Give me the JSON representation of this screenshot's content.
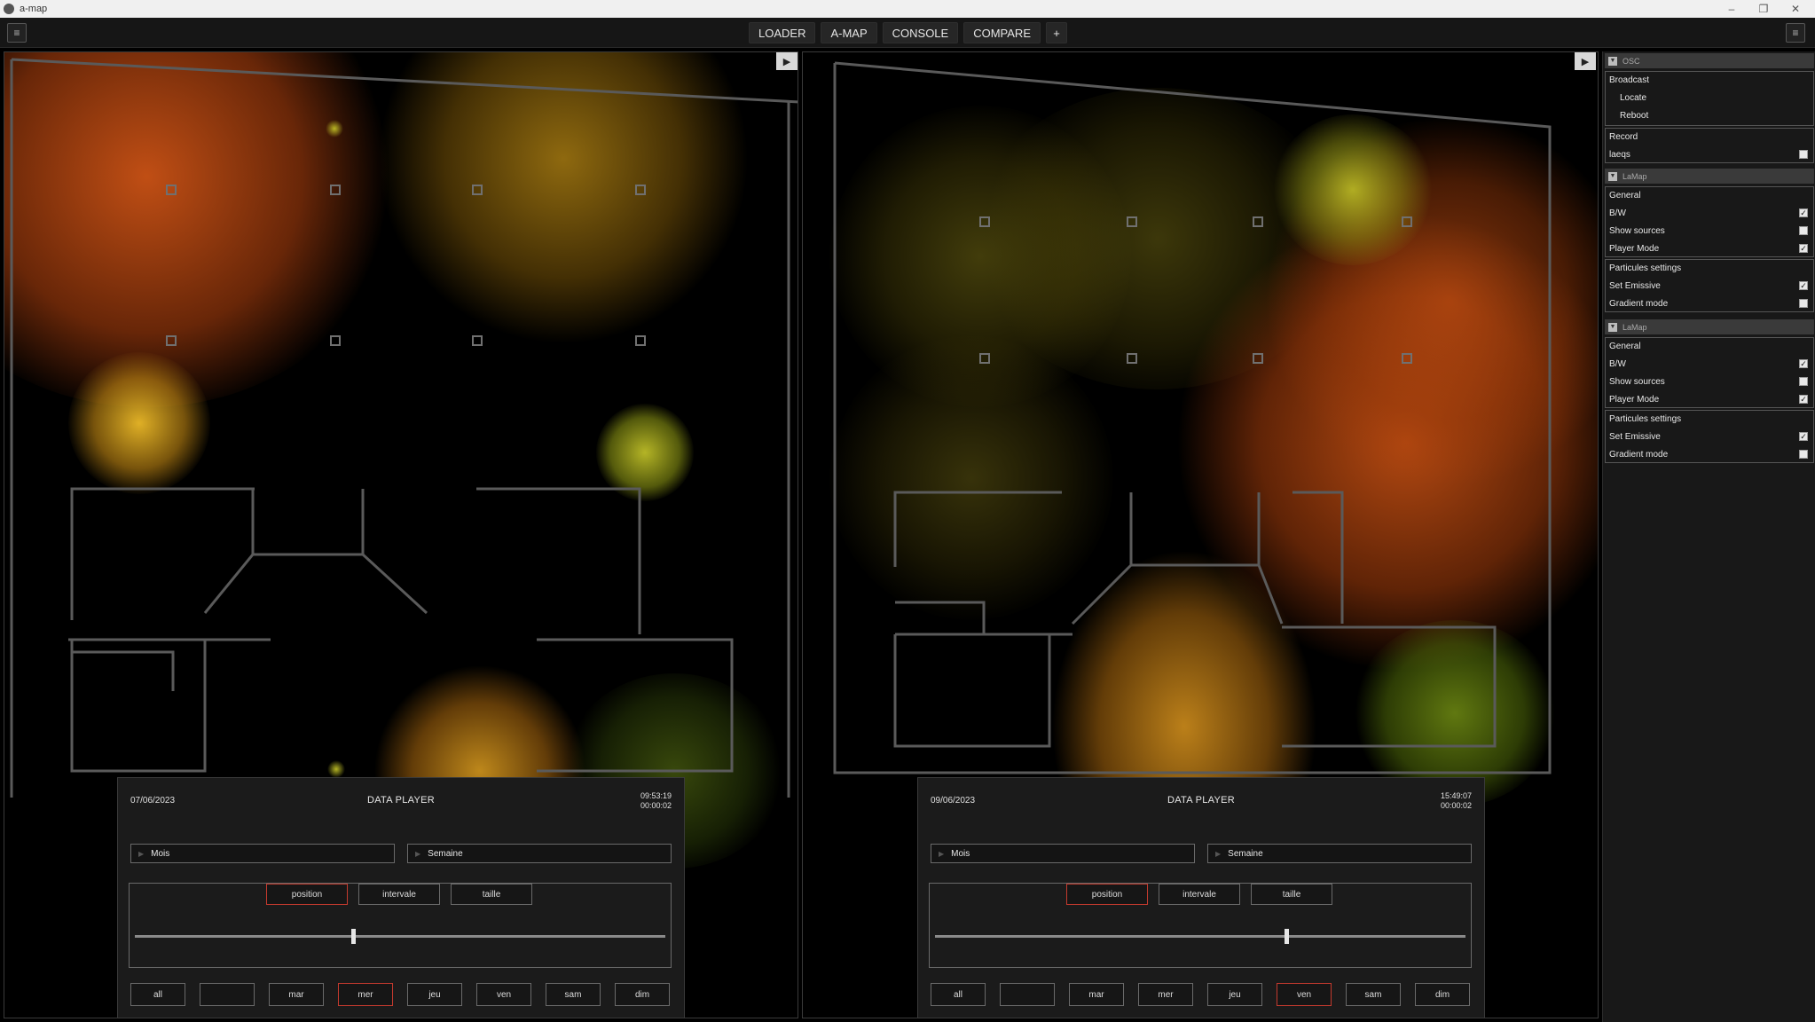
{
  "window": {
    "title": "a-map"
  },
  "nav": {
    "tabs": [
      "LOADER",
      "A-MAP",
      "CONSOLE",
      "COMPARE",
      "+"
    ]
  },
  "players": [
    {
      "date": "07/06/2023",
      "title": "DATA PLAYER",
      "clock": "09:53:19",
      "elapsed": "00:00:02",
      "month_select": "Mois",
      "week_select": "Semaine",
      "modes": [
        "position",
        "intervale",
        "taille"
      ],
      "active_mode": "position",
      "slider_value": 0.41,
      "days": [
        "all",
        "",
        "mar",
        "mer",
        "jeu",
        "ven",
        "sam",
        "dim"
      ],
      "active_day": "mer"
    },
    {
      "date": "09/06/2023",
      "title": "DATA PLAYER",
      "clock": "15:49:07",
      "elapsed": "00:00:02",
      "month_select": "Mois",
      "week_select": "Semaine",
      "modes": [
        "position",
        "intervale",
        "taille"
      ],
      "active_mode": "position",
      "slider_value": 0.66,
      "days": [
        "all",
        "",
        "mar",
        "mer",
        "jeu",
        "ven",
        "sam",
        "dim"
      ],
      "active_day": "ven"
    }
  ],
  "sidebar": {
    "osc": {
      "header": "OSC",
      "broadcast": "Broadcast",
      "locate": "Locate",
      "reboot": "Reboot",
      "record": "Record",
      "laeqs": "laeqs",
      "laeqs_checked": false
    },
    "lamaps": [
      {
        "header": "LaMap",
        "general": "General",
        "bw": "B/W",
        "bw_checked": true,
        "show_sources": "Show sources",
        "show_sources_checked": false,
        "player_mode": "Player Mode",
        "player_mode_checked": true,
        "particules": "Particules settings",
        "set_emissive": "Set Emissive",
        "set_emissive_checked": true,
        "gradient_mode": "Gradient mode",
        "gradient_mode_checked": false
      },
      {
        "header": "LaMap",
        "general": "General",
        "bw": "B/W",
        "bw_checked": true,
        "show_sources": "Show sources",
        "show_sources_checked": false,
        "player_mode": "Player Mode",
        "player_mode_checked": true,
        "particules": "Particules settings",
        "set_emissive": "Set Emissive",
        "set_emissive_checked": true,
        "gradient_mode": "Gradient mode",
        "gradient_mode_checked": false
      }
    ]
  },
  "colors": {
    "active_border": "#c43a2e",
    "orange": "#d2591a",
    "yellow": "#c9a31a",
    "green": "#7a9a1a"
  }
}
